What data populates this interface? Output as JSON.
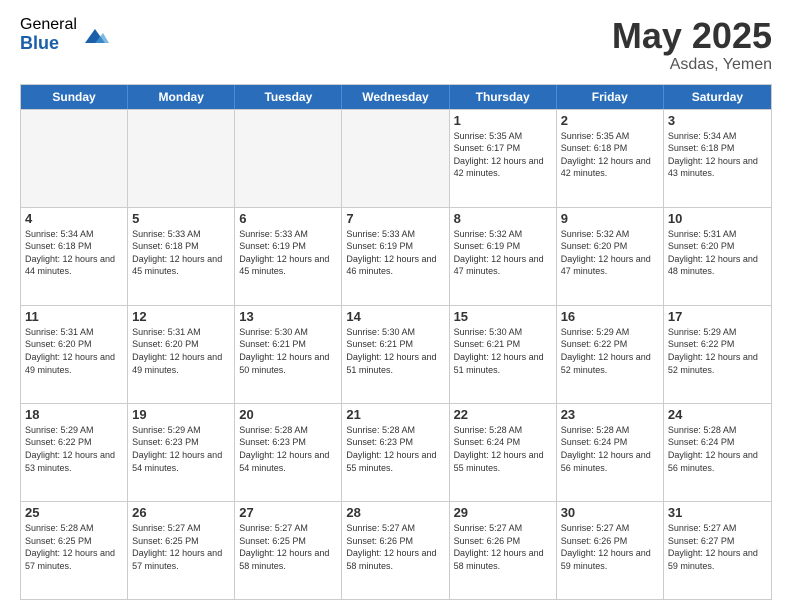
{
  "logo": {
    "general": "General",
    "blue": "Blue"
  },
  "title": "May 2025",
  "subtitle": "Asdas, Yemen",
  "days_of_week": [
    "Sunday",
    "Monday",
    "Tuesday",
    "Wednesday",
    "Thursday",
    "Friday",
    "Saturday"
  ],
  "weeks": [
    [
      {
        "day": "",
        "empty": true
      },
      {
        "day": "",
        "empty": true
      },
      {
        "day": "",
        "empty": true
      },
      {
        "day": "",
        "empty": true
      },
      {
        "day": "1",
        "sunrise": "5:35 AM",
        "sunset": "6:17 PM",
        "daylight": "12 hours and 42 minutes."
      },
      {
        "day": "2",
        "sunrise": "5:35 AM",
        "sunset": "6:18 PM",
        "daylight": "12 hours and 42 minutes."
      },
      {
        "day": "3",
        "sunrise": "5:34 AM",
        "sunset": "6:18 PM",
        "daylight": "12 hours and 43 minutes."
      }
    ],
    [
      {
        "day": "4",
        "sunrise": "5:34 AM",
        "sunset": "6:18 PM",
        "daylight": "12 hours and 44 minutes."
      },
      {
        "day": "5",
        "sunrise": "5:33 AM",
        "sunset": "6:18 PM",
        "daylight": "12 hours and 45 minutes."
      },
      {
        "day": "6",
        "sunrise": "5:33 AM",
        "sunset": "6:19 PM",
        "daylight": "12 hours and 45 minutes."
      },
      {
        "day": "7",
        "sunrise": "5:33 AM",
        "sunset": "6:19 PM",
        "daylight": "12 hours and 46 minutes."
      },
      {
        "day": "8",
        "sunrise": "5:32 AM",
        "sunset": "6:19 PM",
        "daylight": "12 hours and 47 minutes."
      },
      {
        "day": "9",
        "sunrise": "5:32 AM",
        "sunset": "6:20 PM",
        "daylight": "12 hours and 47 minutes."
      },
      {
        "day": "10",
        "sunrise": "5:31 AM",
        "sunset": "6:20 PM",
        "daylight": "12 hours and 48 minutes."
      }
    ],
    [
      {
        "day": "11",
        "sunrise": "5:31 AM",
        "sunset": "6:20 PM",
        "daylight": "12 hours and 49 minutes."
      },
      {
        "day": "12",
        "sunrise": "5:31 AM",
        "sunset": "6:20 PM",
        "daylight": "12 hours and 49 minutes."
      },
      {
        "day": "13",
        "sunrise": "5:30 AM",
        "sunset": "6:21 PM",
        "daylight": "12 hours and 50 minutes."
      },
      {
        "day": "14",
        "sunrise": "5:30 AM",
        "sunset": "6:21 PM",
        "daylight": "12 hours and 51 minutes."
      },
      {
        "day": "15",
        "sunrise": "5:30 AM",
        "sunset": "6:21 PM",
        "daylight": "12 hours and 51 minutes."
      },
      {
        "day": "16",
        "sunrise": "5:29 AM",
        "sunset": "6:22 PM",
        "daylight": "12 hours and 52 minutes."
      },
      {
        "day": "17",
        "sunrise": "5:29 AM",
        "sunset": "6:22 PM",
        "daylight": "12 hours and 52 minutes."
      }
    ],
    [
      {
        "day": "18",
        "sunrise": "5:29 AM",
        "sunset": "6:22 PM",
        "daylight": "12 hours and 53 minutes."
      },
      {
        "day": "19",
        "sunrise": "5:29 AM",
        "sunset": "6:23 PM",
        "daylight": "12 hours and 54 minutes."
      },
      {
        "day": "20",
        "sunrise": "5:28 AM",
        "sunset": "6:23 PM",
        "daylight": "12 hours and 54 minutes."
      },
      {
        "day": "21",
        "sunrise": "5:28 AM",
        "sunset": "6:23 PM",
        "daylight": "12 hours and 55 minutes."
      },
      {
        "day": "22",
        "sunrise": "5:28 AM",
        "sunset": "6:24 PM",
        "daylight": "12 hours and 55 minutes."
      },
      {
        "day": "23",
        "sunrise": "5:28 AM",
        "sunset": "6:24 PM",
        "daylight": "12 hours and 56 minutes."
      },
      {
        "day": "24",
        "sunrise": "5:28 AM",
        "sunset": "6:24 PM",
        "daylight": "12 hours and 56 minutes."
      }
    ],
    [
      {
        "day": "25",
        "sunrise": "5:28 AM",
        "sunset": "6:25 PM",
        "daylight": "12 hours and 57 minutes."
      },
      {
        "day": "26",
        "sunrise": "5:27 AM",
        "sunset": "6:25 PM",
        "daylight": "12 hours and 57 minutes."
      },
      {
        "day": "27",
        "sunrise": "5:27 AM",
        "sunset": "6:25 PM",
        "daylight": "12 hours and 58 minutes."
      },
      {
        "day": "28",
        "sunrise": "5:27 AM",
        "sunset": "6:26 PM",
        "daylight": "12 hours and 58 minutes."
      },
      {
        "day": "29",
        "sunrise": "5:27 AM",
        "sunset": "6:26 PM",
        "daylight": "12 hours and 58 minutes."
      },
      {
        "day": "30",
        "sunrise": "5:27 AM",
        "sunset": "6:26 PM",
        "daylight": "12 hours and 59 minutes."
      },
      {
        "day": "31",
        "sunrise": "5:27 AM",
        "sunset": "6:27 PM",
        "daylight": "12 hours and 59 minutes."
      }
    ]
  ]
}
